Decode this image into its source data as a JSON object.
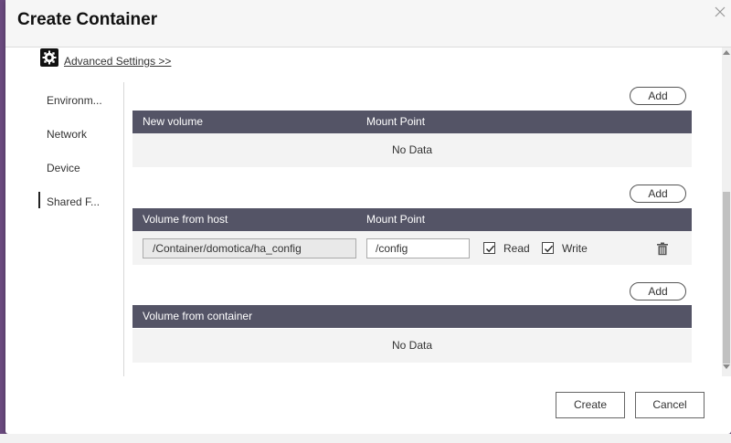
{
  "dialog": {
    "title": "Create Container",
    "advanced_settings": "Advanced Settings >>",
    "create_label": "Create",
    "cancel_label": "Cancel"
  },
  "nav": {
    "items": [
      {
        "label": "Environm..."
      },
      {
        "label": "Network"
      },
      {
        "label": "Device"
      },
      {
        "label": "Shared F..."
      }
    ],
    "active_index": 3
  },
  "sections": {
    "new_volume": {
      "add_label": "Add",
      "col1": "New volume",
      "col2": "Mount Point",
      "empty_text": "No Data"
    },
    "host_volume": {
      "add_label": "Add",
      "col1": "Volume from host",
      "col2": "Mount Point",
      "rows": [
        {
          "host_path": "/Container/domotica/ha_config",
          "mount_point": "/config",
          "read_label": "Read",
          "read_checked": true,
          "write_label": "Write",
          "write_checked": true
        }
      ]
    },
    "container_volume": {
      "add_label": "Add",
      "col1": "Volume from container",
      "empty_text": "No Data"
    }
  },
  "colors": {
    "header_row": "#545466",
    "row_bg": "#f3f3f3",
    "desktop_bg": "#6a4a7e"
  }
}
